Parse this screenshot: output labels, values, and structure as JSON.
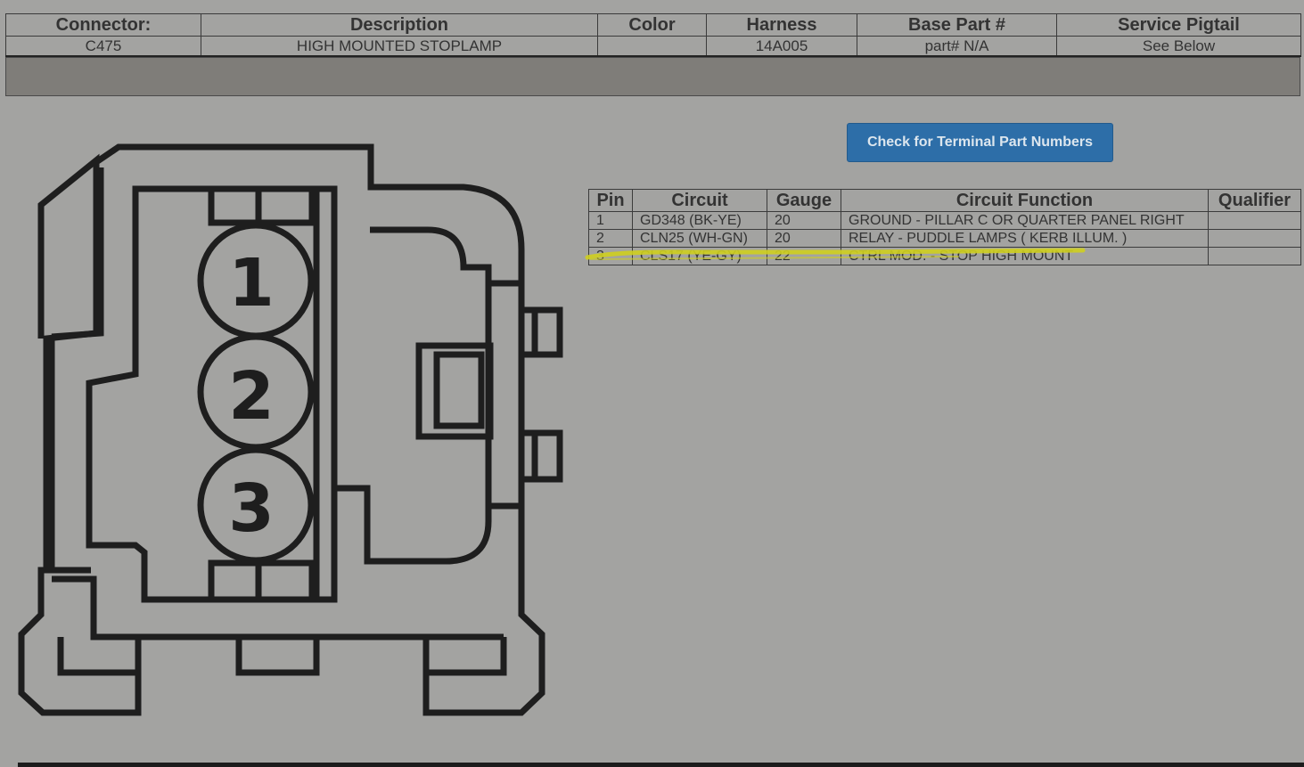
{
  "connector_header": {
    "columns": [
      "Connector:",
      "Description",
      "Color",
      "Harness",
      "Base Part #",
      "Service Pigtail"
    ],
    "row": [
      "C475",
      "HIGH MOUNTED STOPLAMP",
      "",
      "14A005",
      "part# N/A",
      "See Below"
    ]
  },
  "button": {
    "label": "Check for Terminal Part Numbers"
  },
  "pin_table": {
    "columns": [
      "Pin",
      "Circuit",
      "Gauge",
      "Circuit Function",
      "Qualifier"
    ],
    "rows": [
      [
        "1",
        "GD348 (BK-YE)",
        "20",
        "GROUND - PILLAR C OR QUARTER PANEL RIGHT",
        ""
      ],
      [
        "2",
        "CLN25 (WH-GN)",
        "20",
        "RELAY - PUDDLE LAMPS ( KERB ILLUM. )",
        ""
      ],
      [
        "3",
        "CLS17 (YE-GY)",
        "22",
        "CTRL MOD. - STOP HIGH MOUNT",
        ""
      ]
    ],
    "highlighted_pin": "3"
  },
  "diagram": {
    "pins": [
      "1",
      "2",
      "3"
    ]
  },
  "colors": {
    "background": "#a3a3a1",
    "gray_bar": "#7f7d79",
    "button": "#2d6ea8",
    "highlight": "#cfcf1f",
    "diagram_stroke": "#1e1e1e"
  }
}
